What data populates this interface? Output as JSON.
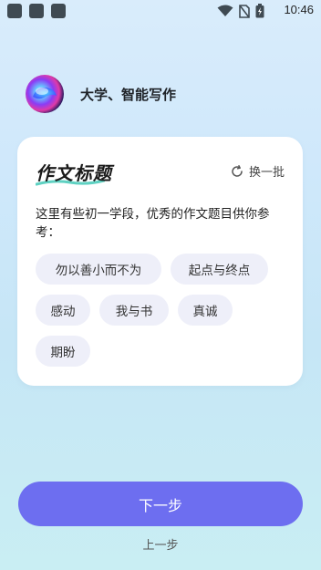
{
  "status_bar": {
    "time": "10:46"
  },
  "header": {
    "title": "大学、智能写作",
    "logo_icon": "app-logo-icon"
  },
  "card": {
    "title": "作文标题",
    "refresh_label": "换一批",
    "description": "这里有些初一学段，优秀的作文题目供你参考：",
    "tags": [
      "勿以善小而不为",
      "起点与终点",
      "感动",
      "我与书",
      "真诚",
      "期盼"
    ]
  },
  "footer": {
    "next_label": "下一步",
    "prev_label": "上一步"
  },
  "colors": {
    "accent": "#6d6ef0",
    "tag_bg": "#eeeff9"
  }
}
